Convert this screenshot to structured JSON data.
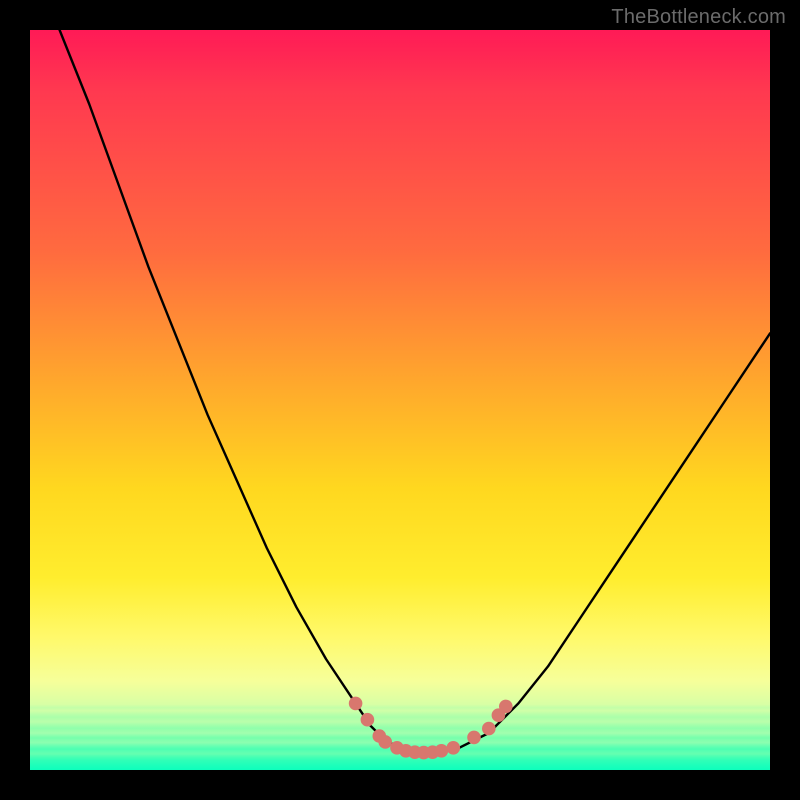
{
  "watermark": "TheBottleneck.com",
  "colors": {
    "frame": "#000000",
    "curve": "#000000",
    "dot_fill": "#d8776e",
    "dot_stroke": "#d8776e",
    "gradient_top": "#ff1a56",
    "gradient_bottom": "#2dffb0"
  },
  "chart_data": {
    "type": "line",
    "title": "",
    "xlabel": "",
    "ylabel": "",
    "xlim": [
      0,
      100
    ],
    "ylim": [
      0,
      100
    ],
    "series": [
      {
        "name": "bottleneck-curve",
        "x": [
          0,
          4,
          8,
          12,
          16,
          20,
          24,
          28,
          32,
          36,
          40,
          44,
          46,
          48,
          50,
          52,
          54,
          56,
          58,
          62,
          66,
          70,
          74,
          78,
          82,
          86,
          90,
          94,
          98,
          100
        ],
        "y": [
          110,
          100,
          90,
          79,
          68,
          58,
          48,
          39,
          30,
          22,
          15,
          9,
          6,
          4,
          3,
          2.5,
          2.3,
          2.5,
          3,
          5,
          9,
          14,
          20,
          26,
          32,
          38,
          44,
          50,
          56,
          59
        ]
      }
    ],
    "markers": [
      {
        "x": 44.0,
        "y": 9.0
      },
      {
        "x": 45.6,
        "y": 6.8
      },
      {
        "x": 47.2,
        "y": 4.6
      },
      {
        "x": 48.0,
        "y": 3.8
      },
      {
        "x": 49.6,
        "y": 3.0
      },
      {
        "x": 50.8,
        "y": 2.6
      },
      {
        "x": 52.0,
        "y": 2.4
      },
      {
        "x": 53.2,
        "y": 2.35
      },
      {
        "x": 54.4,
        "y": 2.4
      },
      {
        "x": 55.6,
        "y": 2.6
      },
      {
        "x": 57.2,
        "y": 3.0
      },
      {
        "x": 60.0,
        "y": 4.4
      },
      {
        "x": 62.0,
        "y": 5.6
      },
      {
        "x": 63.3,
        "y": 7.4
      },
      {
        "x": 64.3,
        "y": 8.6
      }
    ]
  }
}
